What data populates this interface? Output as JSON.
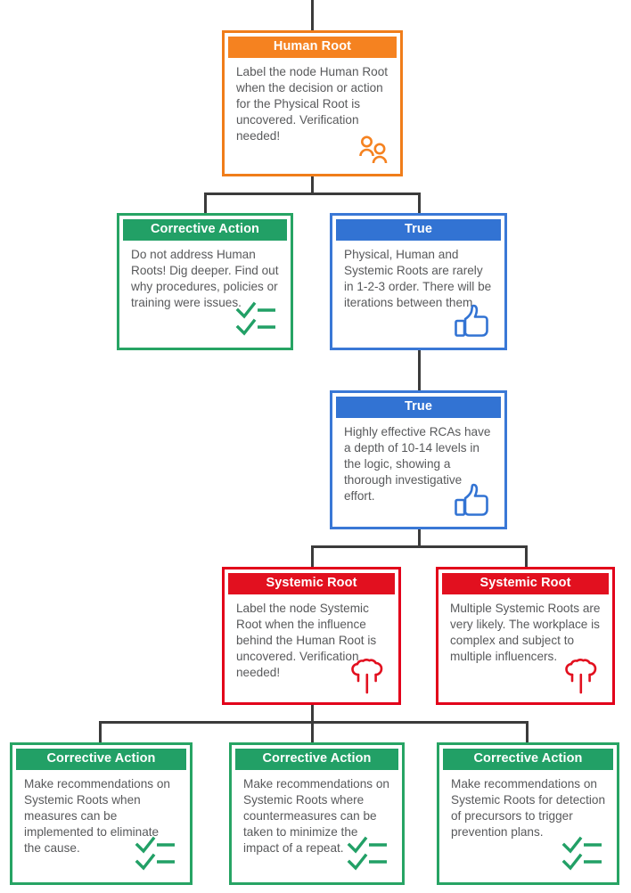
{
  "diagram": {
    "title": "Root Cause Analysis logic tree fragment",
    "colors": {
      "orange": "#f58220",
      "green": "#22a066",
      "blue": "#3273d3",
      "red": "#e2101f",
      "connector": "#3b3b3b",
      "body_text": "#58595b"
    },
    "nodes": [
      {
        "id": "human-root",
        "header": "Human Root",
        "body": "Label the node Human Root when the decision or action for the Physical Root is uncovered. Verification needed!",
        "icon": "people-icon",
        "color": "orange"
      },
      {
        "id": "corrective-action-human",
        "header": "Corrective Action",
        "body": "Do not address Human Roots! Dig deeper. Find out why procedures, policies or training were issues.",
        "icon": "checklist-icon",
        "color": "green"
      },
      {
        "id": "true-iterations",
        "header": "True",
        "body": "Physical, Human and Systemic Roots are rarely in 1-2-3 order. There will be iterations between them.",
        "icon": "thumbs-up-icon",
        "color": "blue"
      },
      {
        "id": "true-depth",
        "header": "True",
        "body": "Highly effective RCAs have a depth of 10-14 levels in the logic, showing a thorough investigative effort.",
        "icon": "thumbs-up-icon",
        "color": "blue"
      },
      {
        "id": "systemic-root-label",
        "header": "Systemic Root",
        "body": "Label the node Systemic Root when the influence behind the Human Root is uncovered. Verification needed!",
        "icon": "tree-icon",
        "color": "red"
      },
      {
        "id": "systemic-root-multiple",
        "header": "Systemic Root",
        "body": "Multiple Systemic Roots are very likely. The workplace is complex and subject to multiple influencers.",
        "icon": "tree-icon",
        "color": "red"
      },
      {
        "id": "corrective-action-eliminate",
        "header": "Corrective Action",
        "body": "Make recommendations on Systemic Roots when measures can be implemented to eliminate the cause.",
        "icon": "checklist-icon",
        "color": "green"
      },
      {
        "id": "corrective-action-minimize",
        "header": "Corrective Action",
        "body": "Make recommendations on Systemic Roots where countermeasures can be taken to minimize the impact of a repeat.",
        "icon": "checklist-icon",
        "color": "green"
      },
      {
        "id": "corrective-action-precursors",
        "header": "Corrective Action",
        "body": "Make recommendations on Systemic Roots for detection of precursors to trigger prevention plans.",
        "icon": "checklist-icon",
        "color": "green"
      }
    ]
  }
}
